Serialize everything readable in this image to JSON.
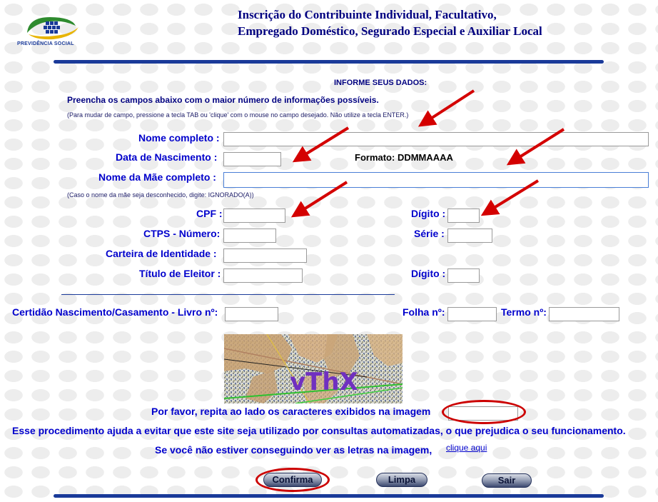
{
  "header": {
    "logo_text": "PREVIDÊNCIA SOCIAL",
    "title_line1": "Inscrição do Contribuinte Individual, Facultativo,",
    "title_line2": "Empregado Doméstico, Segurado Especial e Auxiliar Local"
  },
  "form": {
    "heading": "INFORME SEUS DADOS:",
    "intro": "Preencha os campos abaixo com o maior número de informações possíveis.",
    "hint": "(Para mudar de campo, pressione a tecla TAB ou 'clique' com o mouse no campo desejado. Não utilize a tecla ENTER.)",
    "nome_label": "Nome completo :",
    "nascimento_label": "Data de Nascimento :",
    "formato_text": "Formato: DDMMAAAA",
    "mae_label": "Nome da Mãe completo :",
    "mae_hint": "(Caso o nome da mãe seja desconhecido, digite: IGNORADO(A))",
    "cpf_label": "CPF :",
    "cpf_digito_label": "Dígito :",
    "ctps_label": "CTPS - Número:",
    "serie_label": "Série :",
    "identidade_label": "Carteira de Identidade :",
    "titulo_label": "Título de Eleitor :",
    "titulo_digito_label": "Dígito :",
    "certidao_label": "Certidão Nascimento/Casamento - Livro nº:",
    "folha_label": "Folha nº:",
    "termo_label": "Termo nº:",
    "values": {
      "nome": "",
      "nascimento": "",
      "mae": "",
      "cpf": "",
      "cpf_digito": "",
      "ctps": "",
      "serie": "",
      "identidade": "",
      "titulo": "",
      "titulo_digito": "",
      "livro": "",
      "folha": "",
      "termo": "",
      "captcha": ""
    }
  },
  "captcha": {
    "image_text": "vThX",
    "prompt": "Por favor, repita ao lado os caracteres exibidos na imagem",
    "explain": "Esse procedimento ajuda a evitar que este site seja utilizado por consultas automatizadas, o que prejudica o seu funcionamento.",
    "trouble": "Se você não estiver conseguindo ver as letras na imagem,",
    "link": "clique aqui"
  },
  "buttons": {
    "confirma": "Confirma",
    "limpa": "Limpa",
    "sair": "Sair"
  },
  "colors": {
    "label_blue": "#0000cc",
    "title_navy": "#000080",
    "highlight_red": "#cc0000",
    "arrow_red": "#d40000"
  }
}
